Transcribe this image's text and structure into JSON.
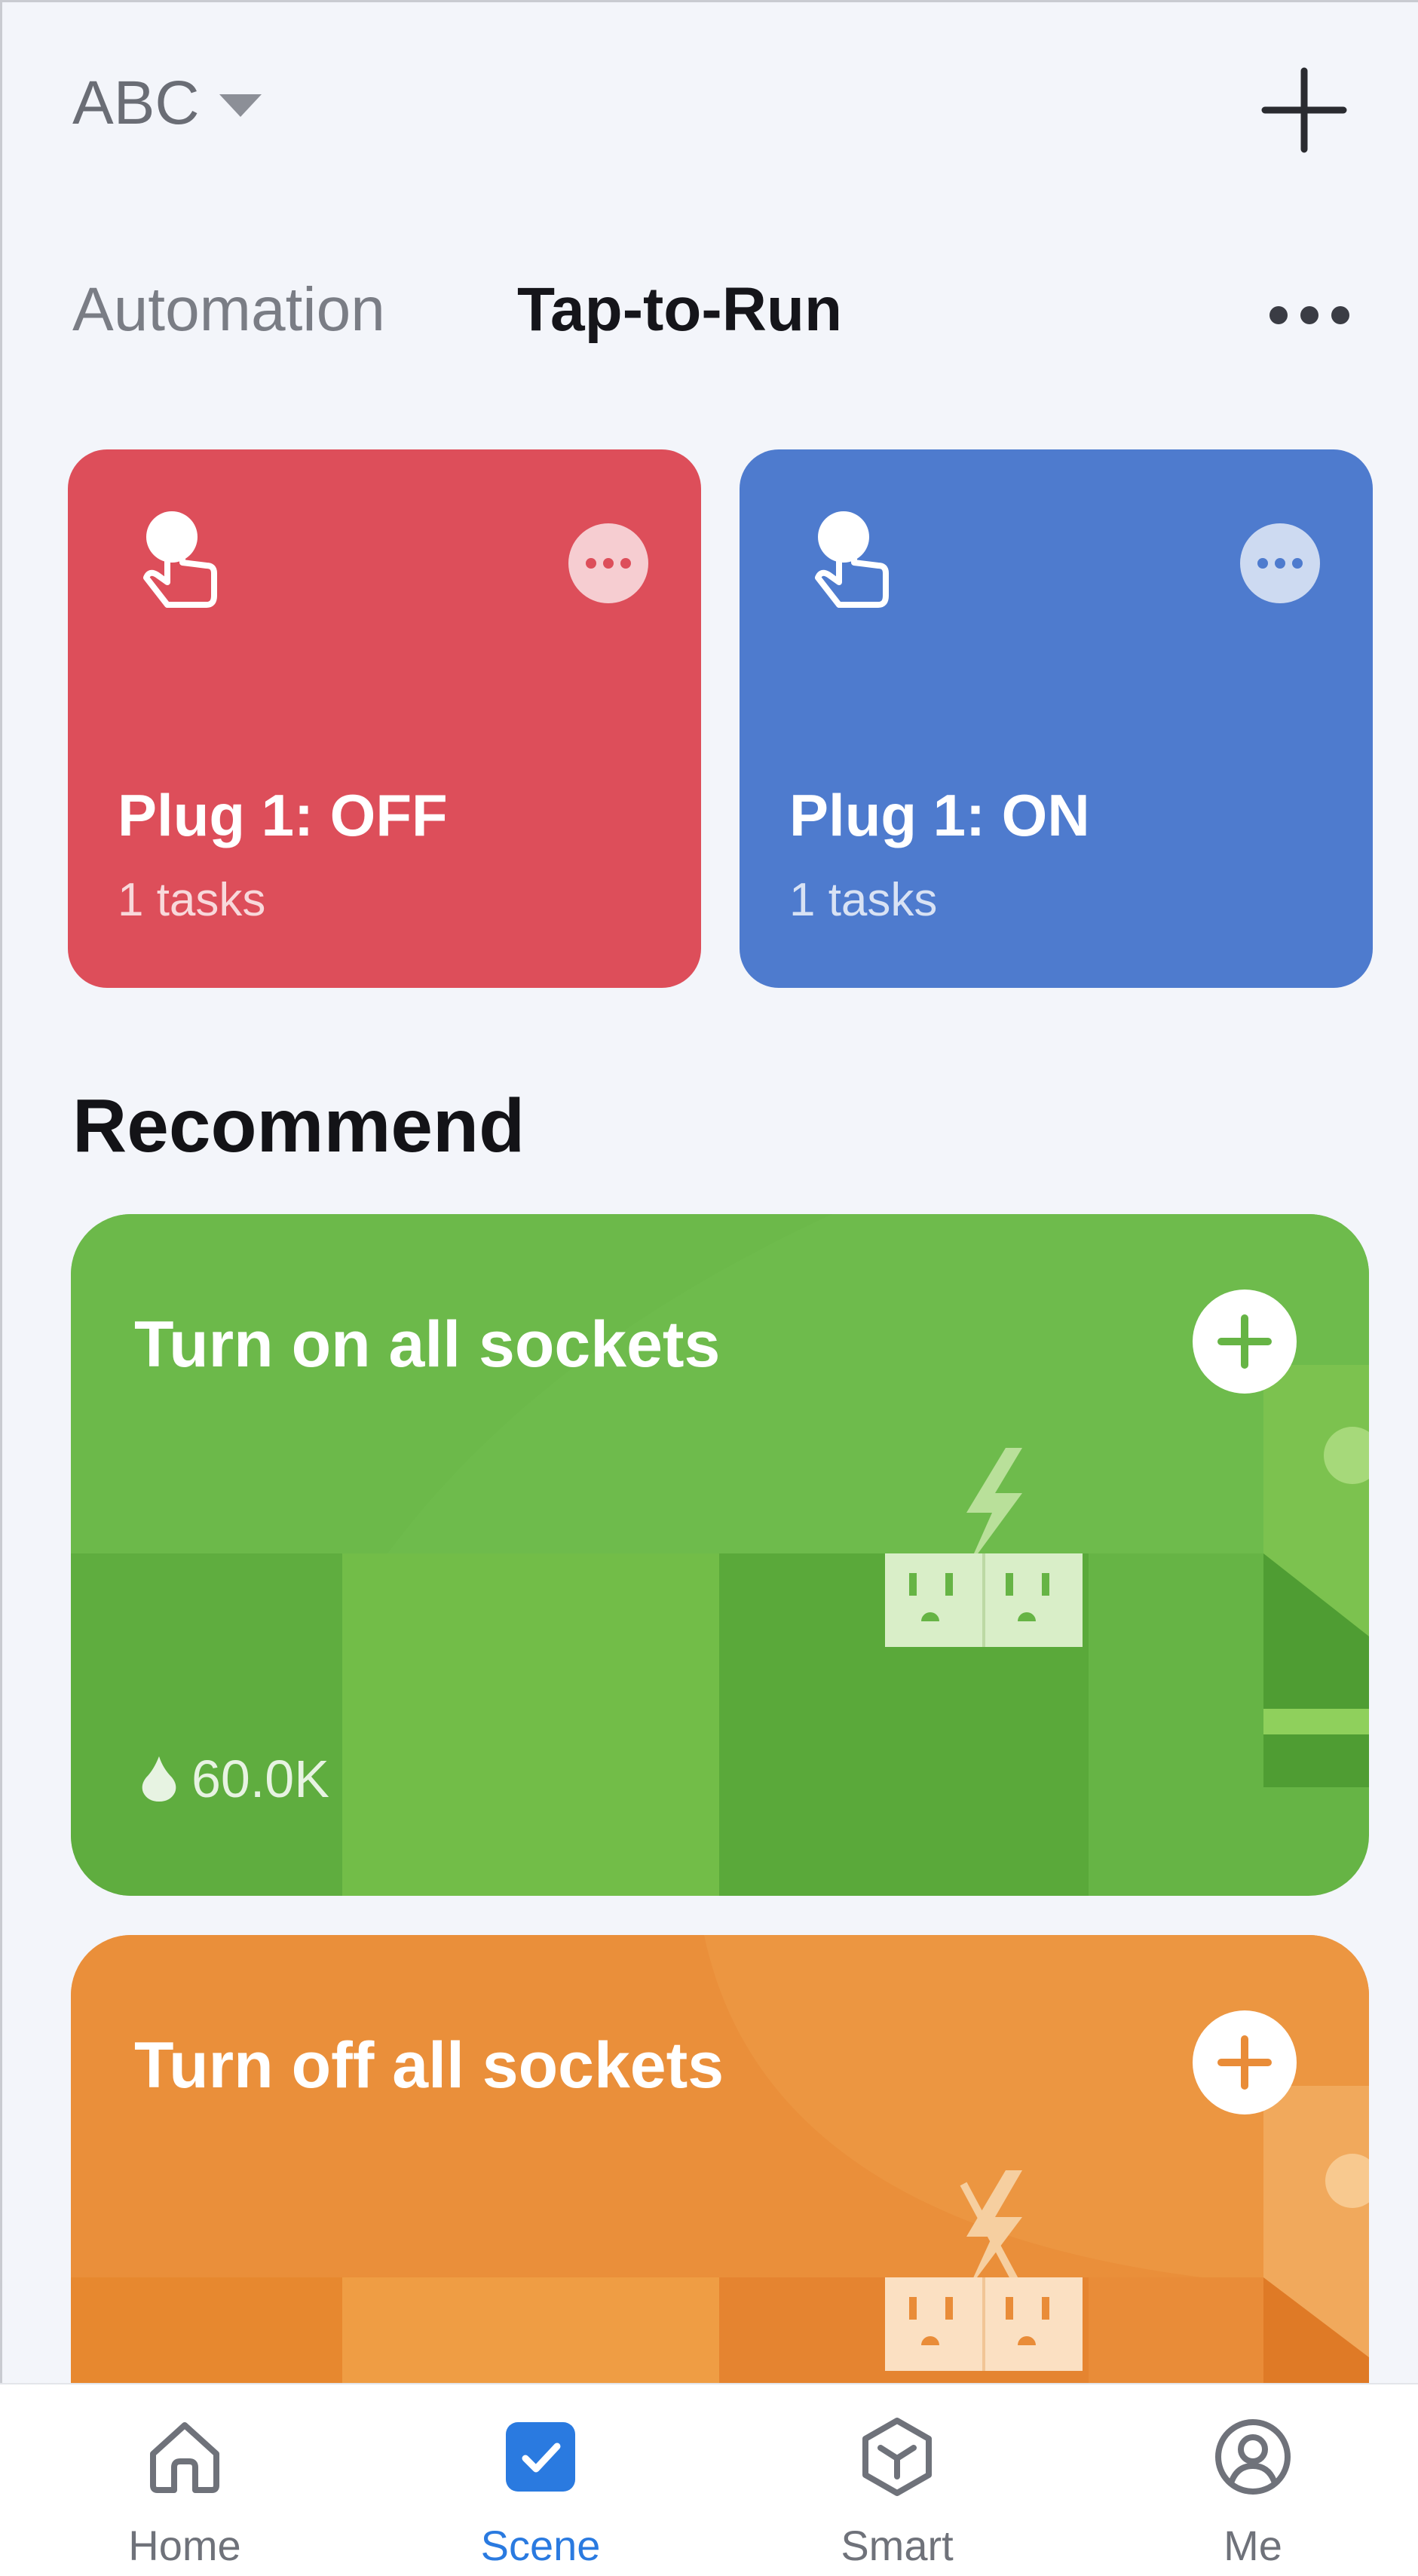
{
  "header": {
    "home_name": "ABC",
    "caret_icon": "caret-down-icon",
    "add_icon": "plus-icon"
  },
  "tabs": [
    {
      "label": "Automation",
      "active": false
    },
    {
      "label": "Tap-to-Run",
      "active": true
    }
  ],
  "more_icon": "more-horizontal-icon",
  "scenes": [
    {
      "name": "Plug 1: OFF",
      "tasks": "1 tasks",
      "color": "#dd4e5a",
      "icon": "tap-hand-icon"
    },
    {
      "name": "Plug 1: ON",
      "tasks": "1 tasks",
      "color": "#4e7bce",
      "icon": "tap-hand-icon"
    }
  ],
  "recommend": {
    "title": "Recommend",
    "cards": [
      {
        "title": "Turn on all sockets",
        "popularity": "60.0K",
        "color": "#66b445",
        "icon": "socket-lightning-icon"
      },
      {
        "title": "Turn off all sockets",
        "color": "#e98c38",
        "icon": "socket-lightning-off-icon"
      }
    ]
  },
  "bottom_nav": [
    {
      "label": "Home",
      "icon": "home-icon",
      "active": false
    },
    {
      "label": "Scene",
      "icon": "scene-check-icon",
      "active": true
    },
    {
      "label": "Smart",
      "icon": "smart-cube-icon",
      "active": false
    },
    {
      "label": "Me",
      "icon": "user-icon",
      "active": false
    }
  ],
  "colors": {
    "background": "#f3f5fa",
    "active_nav": "#2a7ae0"
  }
}
